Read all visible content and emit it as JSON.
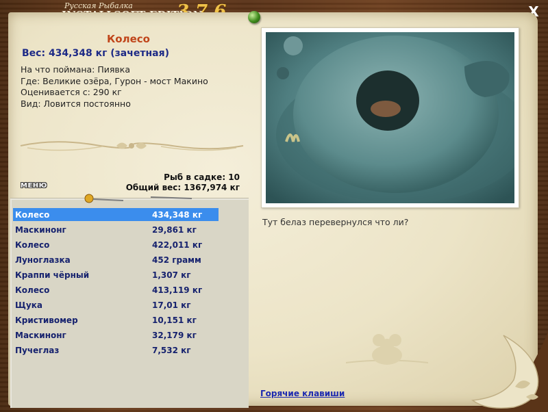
{
  "app": {
    "title_small": "Русская Рыбалка",
    "title_main": "INSTALLSOFT EDITION",
    "version": "3.7.6",
    "close_glyph": "X"
  },
  "fish": {
    "name": "Колесо",
    "weight": "Вес: 434,348 кг (зачетная)",
    "caught_on": "На что поймана: Пиявка",
    "where": "Где: Великие озёра, Гурон - мост Макино",
    "valued_from": "Оценивается с: 290 кг",
    "kind": "Вид: Ловится постоянно"
  },
  "stats": {
    "fish_in_net": "Рыб в садке: 10",
    "total_weight": "Общий вес: 1367,974 кг"
  },
  "menu_label": "МЕНЮ",
  "catch_list": [
    {
      "name": "Колесо",
      "weight": "434,348 кг"
    },
    {
      "name": "Маскинонг",
      "weight": "29,861 кг"
    },
    {
      "name": "Колесо",
      "weight": "422,011 кг"
    },
    {
      "name": "Луноглазка",
      "weight": "452 грамм"
    },
    {
      "name": "Краппи чёрный",
      "weight": "1,307 кг"
    },
    {
      "name": "Колесо",
      "weight": "413,119 кг"
    },
    {
      "name": "Щука",
      "weight": "17,01 кг"
    },
    {
      "name": "Кристивомер",
      "weight": "10,151 кг"
    },
    {
      "name": "Маскинонг",
      "weight": "32,179 кг"
    },
    {
      "name": "Пучеглаз",
      "weight": "7,532 кг"
    }
  ],
  "selected_index": 0,
  "photo_caption": "Тут белаз перевернулся что ли?",
  "hotkeys_link": "Горячие клавиши",
  "colors": {
    "fish_name": "#c0451a",
    "weight_text": "#1d2a86",
    "list_text": "#16226e",
    "selection": "#3b8ded",
    "link": "#1d2ab0"
  }
}
